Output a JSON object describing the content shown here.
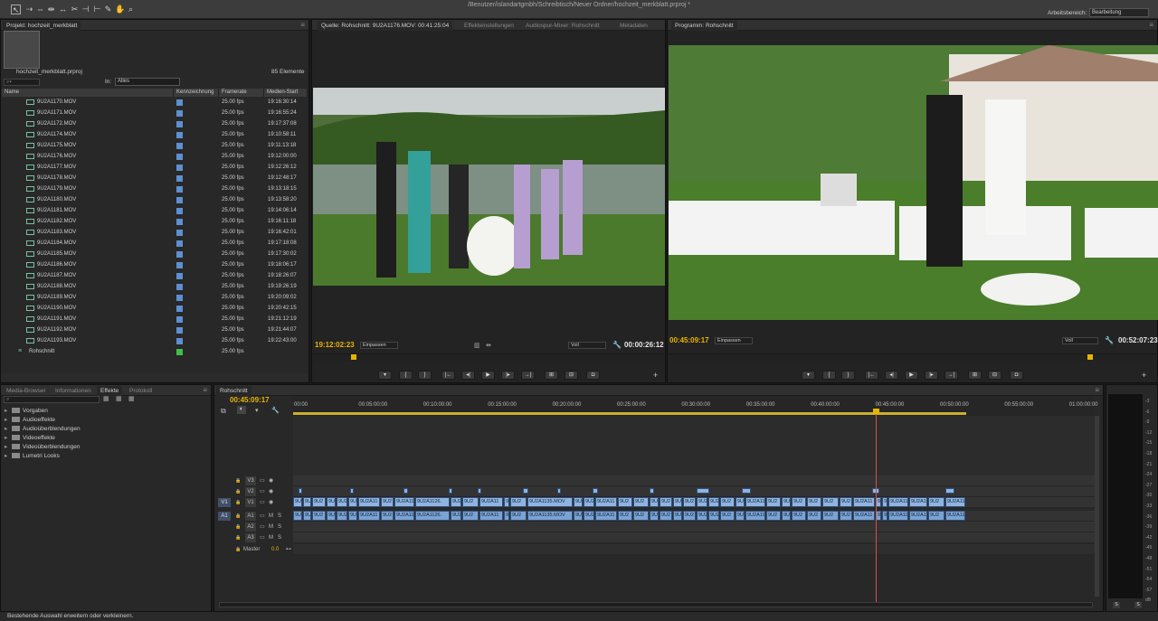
{
  "window_title": "/Benutzer/islandartgmbh/Schreibtisch/Neuer Ordner/hochzeit_merkblatt.prproj *",
  "workspace": {
    "label": "Arbeitsbereich:",
    "value": "Bearbeitung"
  },
  "tools": [
    "selection-tool",
    "track-select-tool",
    "ripple-edit-tool",
    "rolling-edit-tool",
    "rate-stretch-tool",
    "razor-tool",
    "slip-tool",
    "slide-tool",
    "pen-tool",
    "hand-tool",
    "zoom-tool"
  ],
  "project": {
    "tab": "Projekt: hochzeit_merkblatt",
    "filename": "hochzeit_merkblatt.prproj",
    "count": "85 Elemente",
    "in_label": "In:",
    "in_value": "Alles",
    "columns": [
      "Name",
      "Kennzeichnung",
      "Framerate",
      "Medien-Start"
    ],
    "rows": [
      {
        "name": "9U2A1170.MOV",
        "fps": "25.00 fps",
        "start": "19:16:30:14"
      },
      {
        "name": "9U2A1171.MOV",
        "fps": "25.00 fps",
        "start": "19:16:55:24"
      },
      {
        "name": "9U2A1172.MOV",
        "fps": "25.00 fps",
        "start": "19:17:37:08"
      },
      {
        "name": "9U2A1174.MOV",
        "fps": "25.00 fps",
        "start": "19:10:58:11"
      },
      {
        "name": "9U2A1175.MOV",
        "fps": "25.00 fps",
        "start": "19:11:13:18"
      },
      {
        "name": "9U2A1176.MOV",
        "fps": "25.00 fps",
        "start": "19:12:00:00"
      },
      {
        "name": "9U2A1177.MOV",
        "fps": "25.00 fps",
        "start": "19:12:26:12"
      },
      {
        "name": "9U2A1178.MOV",
        "fps": "25.00 fps",
        "start": "19:12:48:17"
      },
      {
        "name": "9U2A1179.MOV",
        "fps": "25.00 fps",
        "start": "19:13:18:15"
      },
      {
        "name": "9U2A1180.MOV",
        "fps": "25.00 fps",
        "start": "19:13:58:20"
      },
      {
        "name": "9U2A1181.MOV",
        "fps": "25.00 fps",
        "start": "19:14:06:14"
      },
      {
        "name": "9U2A1182.MOV",
        "fps": "25.00 fps",
        "start": "19:16:11:18"
      },
      {
        "name": "9U2A1183.MOV",
        "fps": "25.00 fps",
        "start": "19:16:42:01"
      },
      {
        "name": "9U2A1184.MOV",
        "fps": "25.00 fps",
        "start": "19:17:18:08"
      },
      {
        "name": "9U2A1185.MOV",
        "fps": "25.00 fps",
        "start": "19:17:30:02"
      },
      {
        "name": "9U2A1186.MOV",
        "fps": "25.00 fps",
        "start": "19:18:06:17"
      },
      {
        "name": "9U2A1187.MOV",
        "fps": "25.00 fps",
        "start": "19:18:26:07"
      },
      {
        "name": "9U2A1188.MOV",
        "fps": "25.00 fps",
        "start": "19:19:26:19"
      },
      {
        "name": "9U2A1189.MOV",
        "fps": "25.00 fps",
        "start": "19:20:09:02"
      },
      {
        "name": "9U2A1190.MOV",
        "fps": "25.00 fps",
        "start": "19:20:42:15"
      },
      {
        "name": "9U2A1191.MOV",
        "fps": "25.00 fps",
        "start": "19:21:12:19"
      },
      {
        "name": "9U2A1192.MOV",
        "fps": "25.00 fps",
        "start": "19:21:44:07"
      },
      {
        "name": "9U2A1193.MOV",
        "fps": "25.00 fps",
        "start": "19:22:43:00"
      }
    ],
    "sequence": {
      "name": "Rohschnitt",
      "fps": "25.00 fps"
    },
    "label_colors": {
      "clip": "#5e8fd0",
      "sequence": "#3fbf4a"
    }
  },
  "source": {
    "tabs": [
      "Quelle: Rohschnitt: 9U2A1176.MOV: 00:41:25:04",
      "Effekteinstellungen",
      "Audiospur-Mixer: Rohschnitt",
      "Metadaten"
    ],
    "tc_left": "19:12:02:23",
    "fit": "Einpassen",
    "quality": "Voll",
    "tc_right": "00:00:26:12"
  },
  "program": {
    "tab": "Programm: Rohschnitt",
    "tc_left": "00:45:09:17",
    "fit": "Einpassen",
    "quality": "Voll",
    "tc_right": "00:52:07:23"
  },
  "effects_panel": {
    "tabs": [
      "Media-Browser",
      "Informationen",
      "Effekte",
      "Protokoll"
    ],
    "items": [
      "Vorgaben",
      "Audioeffekte",
      "Audioüberblendungen",
      "Videoeffekte",
      "Videoüberblendungen",
      "Lumetri Looks"
    ]
  },
  "timeline": {
    "tab": "Rohschnitt",
    "timecode": "00:45:09:17",
    "ruler": [
      "00:00",
      "00:05:00:00",
      "00:10:00:00",
      "00:15:00:00",
      "00:20:00:00",
      "00:25:00:00",
      "00:30:00:00",
      "00:35:00:00",
      "00:40:00:00",
      "00:45:00:00",
      "00:50:00:00",
      "00:55:00:00",
      "01:00:00:00"
    ],
    "tracks": {
      "video": [
        "V3",
        "V2",
        "V1"
      ],
      "audio": [
        "A1",
        "A2",
        "A3"
      ],
      "source_v": "V1",
      "source_a": "A1",
      "master_label": "Master",
      "master_value": "0.0"
    },
    "clip_labels": [
      "9U2A1126.",
      "9U2A1135.MOV",
      "9U2A11",
      "9U2A1",
      "9U2"
    ]
  },
  "meter_scale": [
    "-3",
    "-6",
    "-9",
    "-12",
    "-15",
    "-18",
    "-21",
    "-24",
    "-27",
    "-30",
    "-33",
    "-36",
    "-39",
    "-42",
    "-45",
    "-48",
    "-51",
    "-54",
    "-57",
    "dB"
  ],
  "meter_buttons": [
    "S",
    "S"
  ],
  "status_text": "Bestehende Auswahl erweitern oder verkleinern."
}
